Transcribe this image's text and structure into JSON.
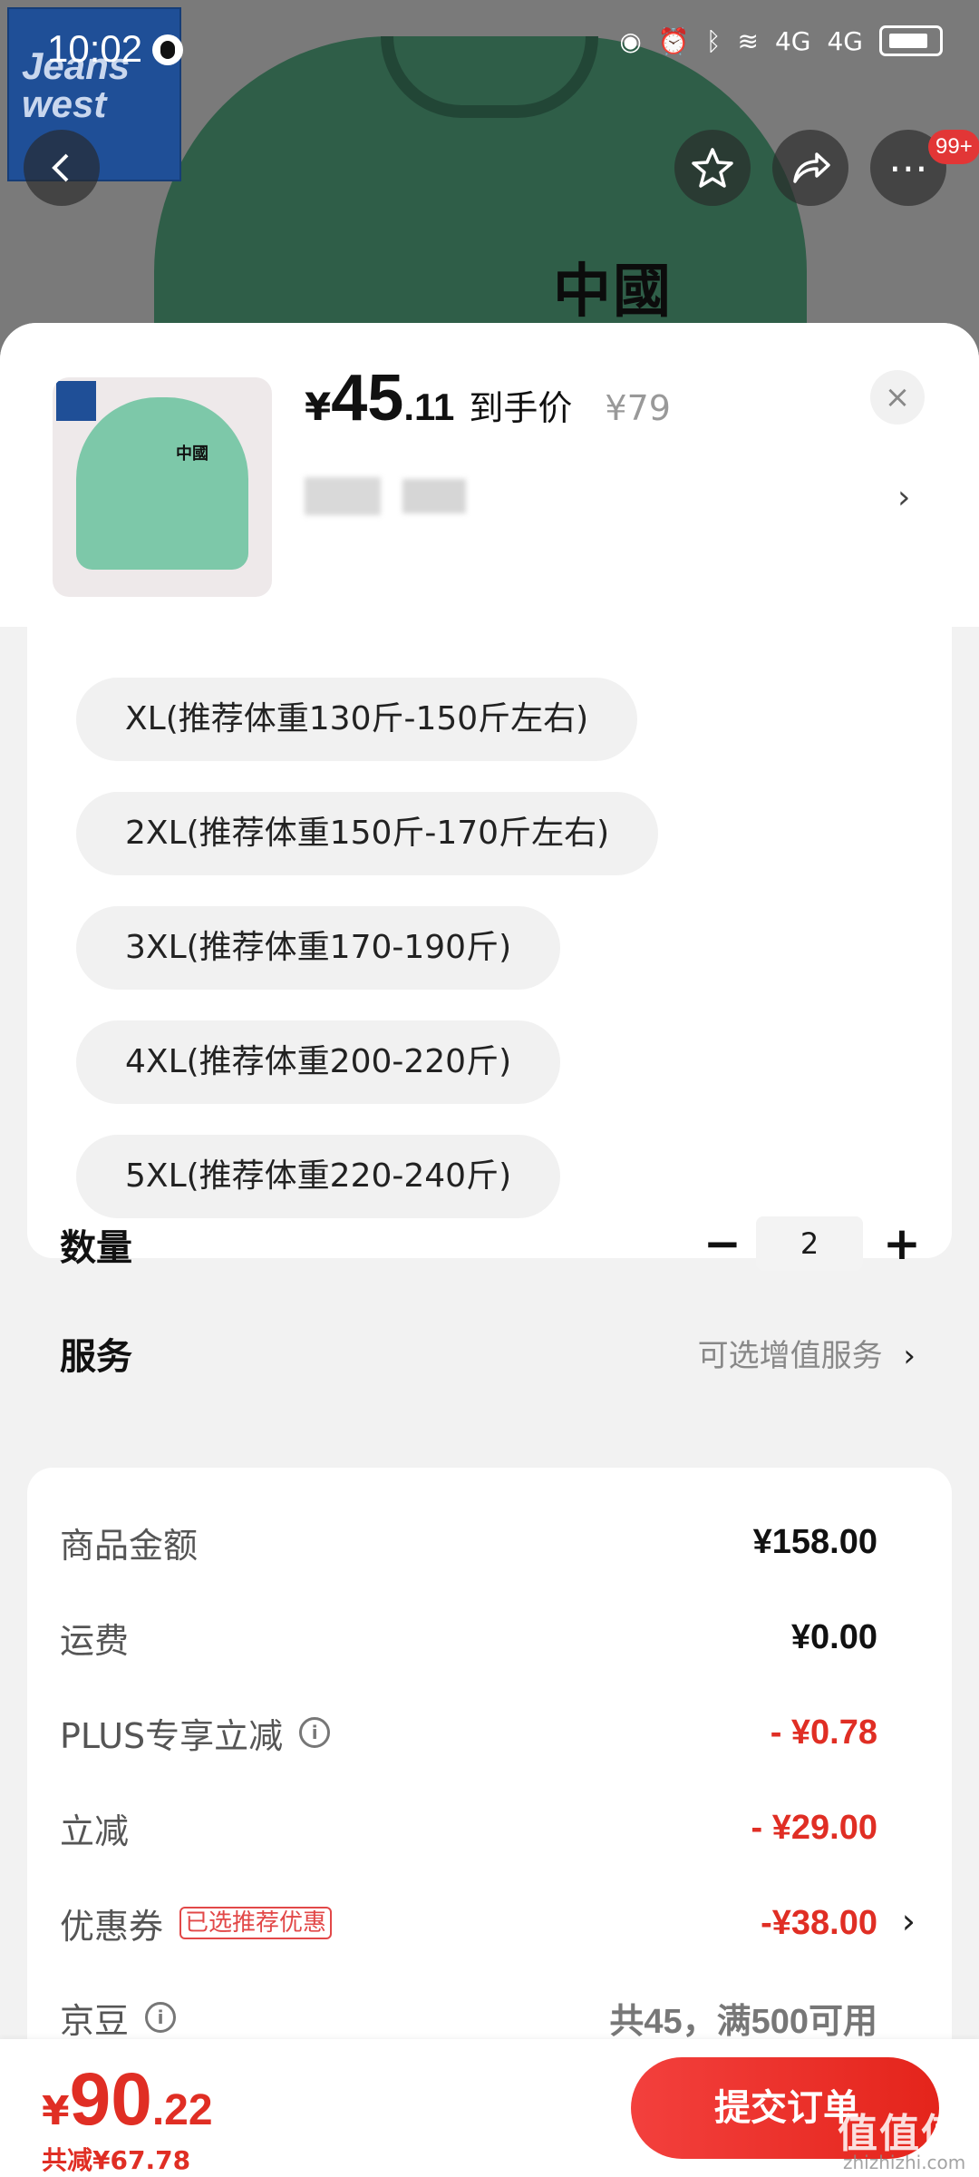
{
  "status_bar": {
    "time": "10:02",
    "net1": "4G",
    "net2": "4G"
  },
  "background": {
    "brand_logo": "Jeans west",
    "print_text": "中國",
    "cart_badge": "99+"
  },
  "product": {
    "price_symbol": "¥",
    "price_int": "45",
    "price_dec": ".11",
    "price_label": "到手价",
    "original_price": "¥79",
    "close_glyph": "×",
    "arrow": "›"
  },
  "sizes": [
    "XL(推荐体重130斤-150斤左右)",
    "2XL(推荐体重150斤-170斤左右)",
    "3XL(推荐体重170-190斤)",
    "4XL(推荐体重200-220斤)",
    "5XL(推荐体重220-240斤)"
  ],
  "quantity": {
    "label": "数量",
    "minus": "−",
    "value": "2",
    "plus": "+"
  },
  "service": {
    "label": "服务",
    "link": "可选增值服务",
    "arrow": "›"
  },
  "fees": {
    "goods_label": "商品金额",
    "goods_value": "¥158.00",
    "shipping_label": "运费",
    "shipping_value": "¥0.00",
    "plus_label": "PLUS专享立减",
    "plus_value": "- ¥0.78",
    "discount_label": "立减",
    "discount_value": "- ¥29.00",
    "coupon_label": "优惠券",
    "coupon_tag": "已选推荐优惠",
    "coupon_value": "-¥38.00",
    "jingdou_label": "京豆",
    "jingdou_value": "共45，满500可用",
    "info_glyph": "i",
    "arrow": "›"
  },
  "footer": {
    "total_symbol": "¥",
    "total_int": "90",
    "total_dec": ".22",
    "saved": "共减¥67.78",
    "submit": "提交订单",
    "watermark": "值值值",
    "watermark_url": "zhizhizhi.com"
  },
  "colors": {
    "accent": "#e02e24",
    "sheet": "#f2f2f2"
  }
}
